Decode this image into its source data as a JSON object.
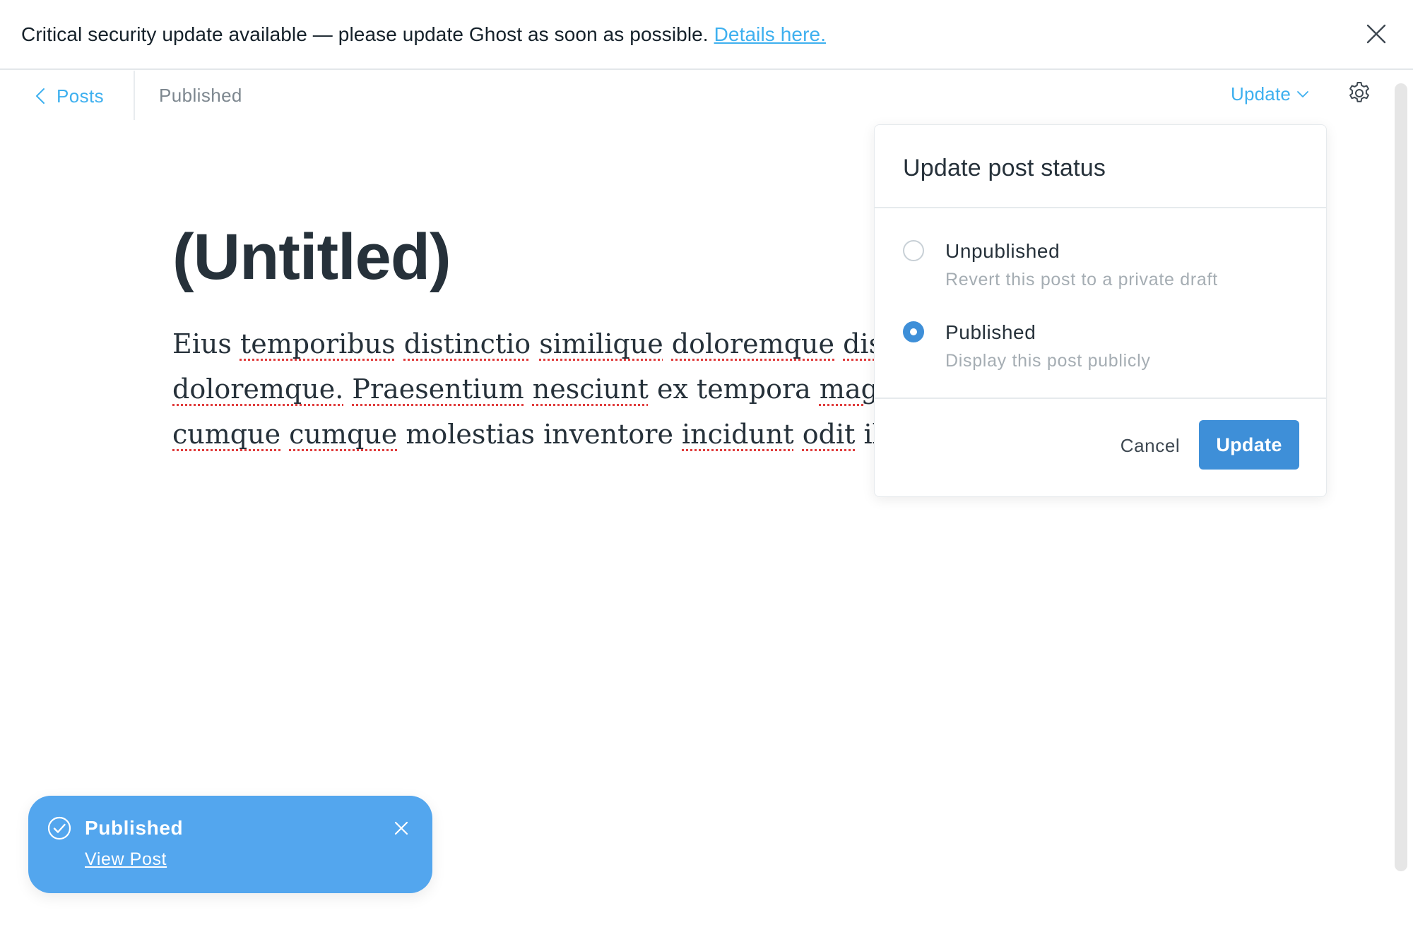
{
  "banner": {
    "message": "Critical security update available — please update Ghost as soon as possible.",
    "link_label": "Details here.",
    "close_icon": "close-icon"
  },
  "header": {
    "back_label": "Posts",
    "status": "Published",
    "update_label": "Update",
    "settings_icon": "gear-icon"
  },
  "editor": {
    "title": "(Untitled)",
    "body_lines": [
      "Eius temporibus distinctio similique doloremque distinc",
      "doloremque. Praesentium nesciunt ex tempora magnam",
      "cumque cumque molestias inventore incidunt odit illo."
    ]
  },
  "popover": {
    "title": "Update post status",
    "options": [
      {
        "label": "Unpublished",
        "description": "Revert this post to a private draft",
        "selected": false
      },
      {
        "label": "Published",
        "description": "Display this post publicly",
        "selected": true
      }
    ],
    "cancel_label": "Cancel",
    "update_label": "Update",
    "accent_color": "#3e8fd8"
  },
  "toast": {
    "title": "Published",
    "link_label": "View Post",
    "color": "#53a6ee"
  }
}
